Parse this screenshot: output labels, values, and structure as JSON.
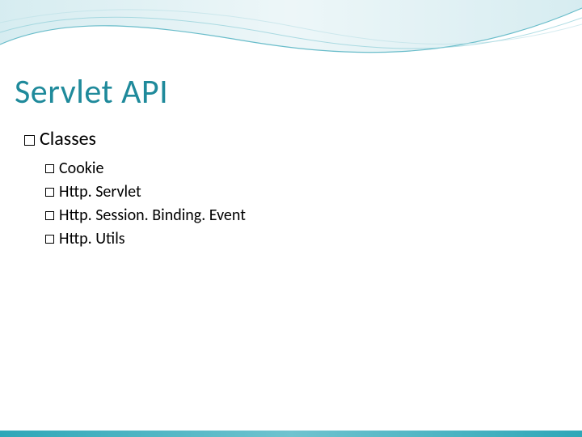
{
  "slide": {
    "title": "Servlet API",
    "section": {
      "label": "Classes"
    },
    "items": [
      {
        "label": "Cookie"
      },
      {
        "label": "Http. Servlet"
      },
      {
        "label": "Http. Session. Binding. Event"
      },
      {
        "label": "Http. Utils"
      }
    ]
  }
}
